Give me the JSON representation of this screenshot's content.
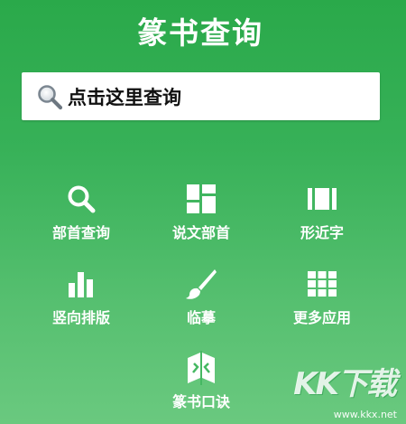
{
  "header": {
    "title": "篆书查询"
  },
  "search": {
    "placeholder": "点击这里查询",
    "icon": "search-icon"
  },
  "tiles": [
    {
      "label": "部首查询",
      "icon": "magnifier-icon"
    },
    {
      "label": "说文部首",
      "icon": "grid-blocks-icon"
    },
    {
      "label": "形近字",
      "icon": "columns-icon"
    },
    {
      "label": "竖向排版",
      "icon": "vertical-bars-icon"
    },
    {
      "label": "临摹",
      "icon": "brush-icon"
    },
    {
      "label": "更多应用",
      "icon": "apps-grid-icon"
    },
    {
      "label": "篆书口诀",
      "icon": "book-icon"
    }
  ],
  "watermark": {
    "logo": "KK下载",
    "url": "www.kkx.net"
  },
  "colors": {
    "background_top": "#2aa94a",
    "background_bottom": "#6ac97f",
    "foreground": "#ffffff"
  }
}
